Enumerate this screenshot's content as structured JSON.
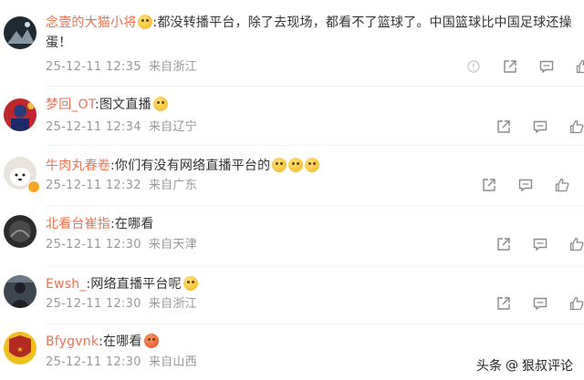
{
  "comments": [
    {
      "name": "念壹的大猫小将",
      "content": ":都没转播平台，除了去现场，都看不了篮球了。中国篮球比中国足球还操蛋！",
      "time": "25-12-11 12:35",
      "location": "来自浙江",
      "avatar_color": "#1f2a33"
    },
    {
      "name": "梦回_OT",
      "content": ":图文直播",
      "time": "25-12-11 12:34",
      "location": "来自辽宁",
      "avatar_color": "#c0262d"
    },
    {
      "name": "牛肉丸春卷",
      "content": ":你们有没有网络直播平台的",
      "time": "25-12-11 12:32",
      "location": "来自广东",
      "avatar_color": "#e9e4de"
    },
    {
      "name": "北看台崔指",
      "content": ":在哪看",
      "time": "25-12-11 12:30",
      "location": "来自天津",
      "avatar_color": "#2b2b2b"
    },
    {
      "name": "Ewsh_",
      "content": ":网络直播平台呢",
      "time": "25-12-11 12:30",
      "location": "来自浙江",
      "avatar_color": "#3d4650"
    },
    {
      "name": "Bfygvnk",
      "content": ":在哪看",
      "time": "25-12-11 12:30",
      "location": "来自山西",
      "avatar_color": "#f0c020"
    }
  ],
  "watermark": {
    "prefix": "头条",
    "at": "@",
    "author": "狠叔评论"
  },
  "colors": {
    "username": "#eb7350",
    "meta": "#999999",
    "text": "#333333"
  }
}
